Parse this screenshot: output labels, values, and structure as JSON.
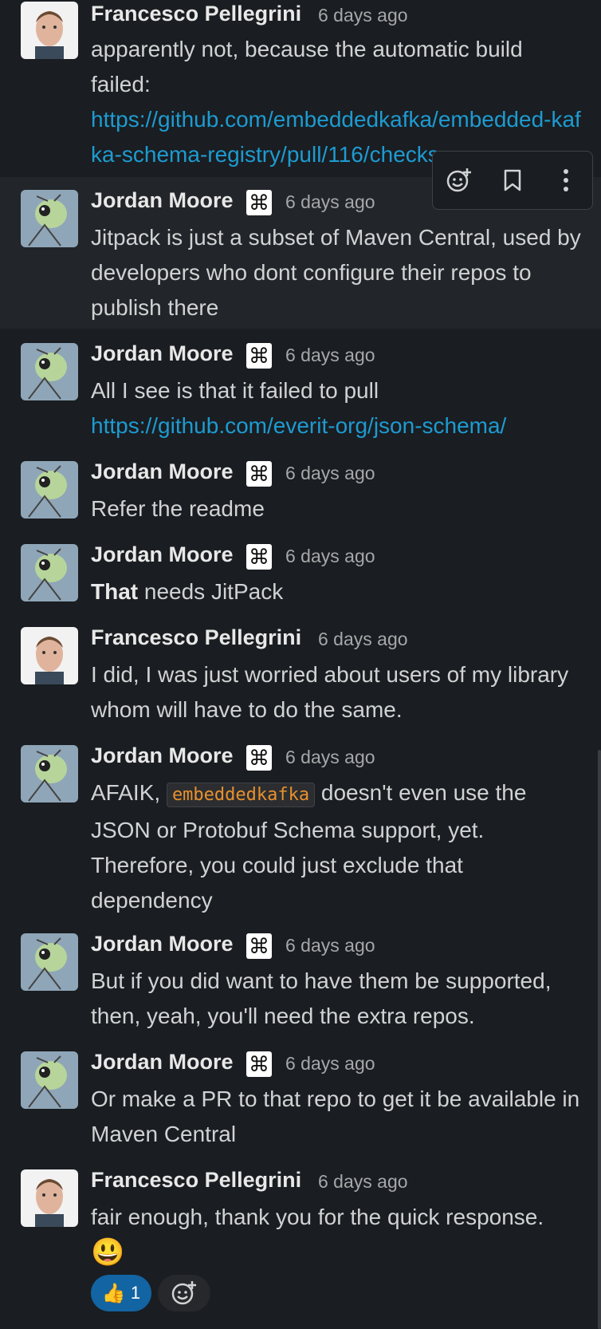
{
  "messages": [
    {
      "author": "Francesco Pellegrini",
      "time": "6 days ago",
      "text": "apparently not, because the automatic build failed:",
      "link": "https://github.com/embeddedkafka/embedded-kafka-schema-registry/pull/116/checks"
    },
    {
      "author": "Jordan Moore",
      "time": "6 days ago",
      "text": "Jitpack is just a subset of Maven Central, used by developers who dont configure their repos to publish there"
    },
    {
      "author": "Jordan Moore",
      "time": "6 days ago",
      "text": "All I see is that it failed to pull",
      "link": "https://github.com/everit-org/json-schema/"
    },
    {
      "author": "Jordan Moore",
      "time": "6 days ago",
      "text": "Refer the readme"
    },
    {
      "author": "Jordan Moore",
      "time": "6 days ago",
      "text_bold": "That",
      "text": " needs JitPack"
    },
    {
      "author": "Francesco Pellegrini",
      "time": "6 days ago",
      "text": "I did, I was just worried about users of my library whom will have to do the same."
    },
    {
      "author": "Jordan Moore",
      "time": "6 days ago",
      "text_pre": "AFAIK, ",
      "code": "embeddedkafka",
      "text": " doesn't even use the JSON or Protobuf Schema support, yet. Therefore, you could just exclude that dependency"
    },
    {
      "author": "Jordan Moore",
      "time": "6 days ago",
      "text": "But if you did want to have them be supported, then, yeah, you'll need the extra repos."
    },
    {
      "author": "Jordan Moore",
      "time": "6 days ago",
      "text": "Or make a PR to that repo to get it be available in Maven Central"
    },
    {
      "author": "Francesco Pellegrini",
      "time": "6 days ago",
      "text": "fair enough, thank you for the quick response.",
      "emoji": "😃",
      "reaction_count": "1",
      "reaction_emoji": "👍"
    }
  ],
  "icons": {
    "badge": "command-key-badge-icon",
    "toolbar": [
      "add-reaction-icon",
      "bookmark-icon",
      "more-actions-icon"
    ]
  },
  "colors": {
    "background": "#1a1d21",
    "highlight": "#222529",
    "link": "#1d9bd1",
    "code": "#e8912d",
    "reaction_bg": "#1264a3"
  }
}
